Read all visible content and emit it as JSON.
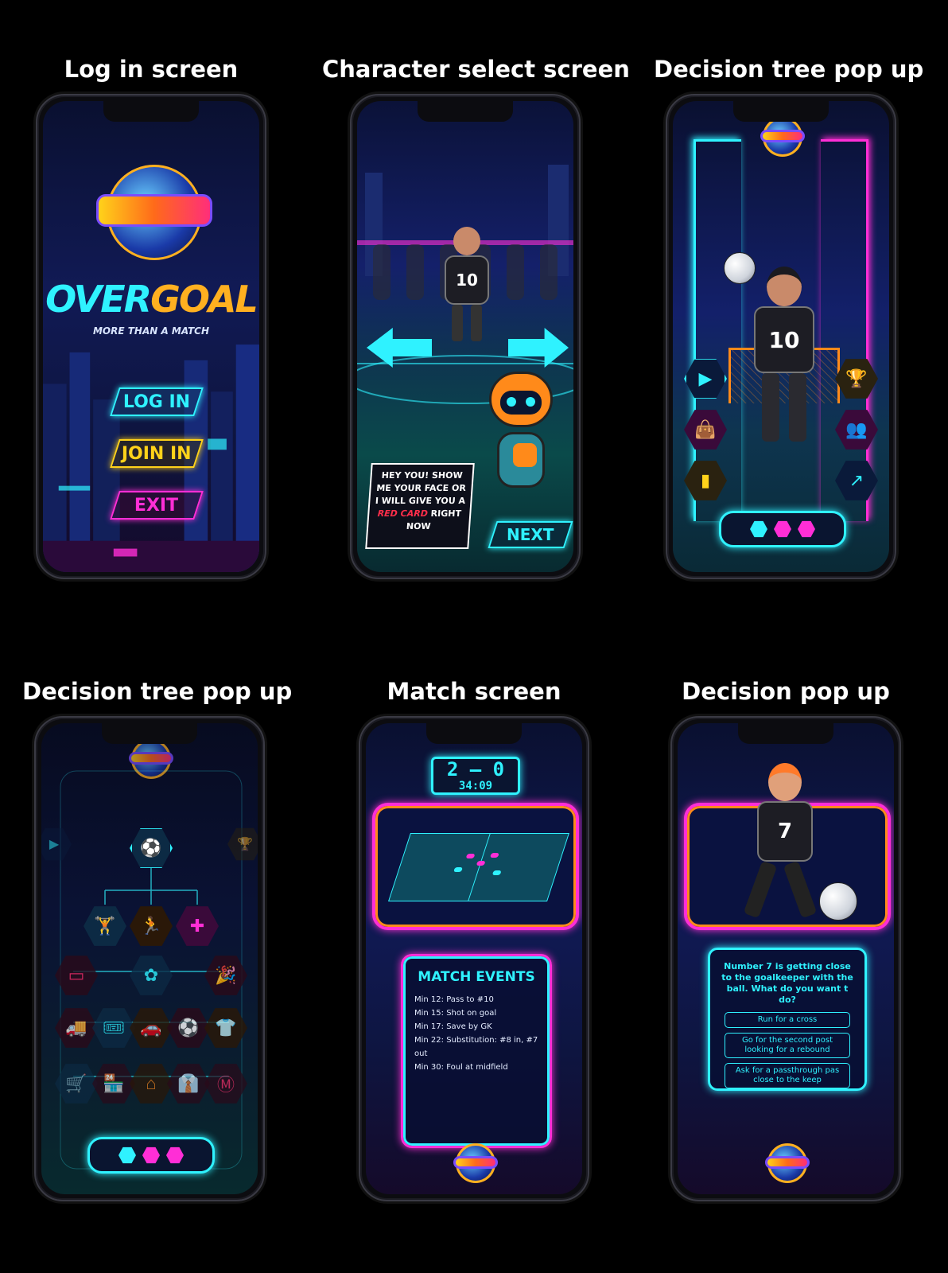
{
  "titles": {
    "login": "Log in screen",
    "character": "Character select screen",
    "tree1": "Decision tree pop up",
    "tree2": "Decision tree pop up",
    "match": "Match screen",
    "decision": "Decision pop up"
  },
  "login": {
    "logo_left": "OVER",
    "logo_right": "GOAL",
    "tagline": "MORE THAN A MATCH",
    "login_label": "LOG IN",
    "join_label": "JOIN IN",
    "exit_label": "EXIT"
  },
  "character": {
    "player_number": "10",
    "speech_line1": "HEY YOU! SHOW",
    "speech_line2": "ME YOUR FACE OR",
    "speech_line3": "I WILL GIVE YOU A",
    "speech_red": "RED CARD",
    "speech_line4_rest": " RIGHT",
    "speech_line5": "NOW",
    "next_label": "NEXT"
  },
  "tree1": {
    "player_number": "10"
  },
  "match": {
    "score": "2 – 0",
    "clock": "34:09",
    "events_title": "MATCH EVENTS",
    "events": [
      "Min 12: Pass to #10",
      "Min 15: Shot on goal",
      "Min 17: Save by GK",
      "Min 22: Substitution: #8 in, #7 out",
      "Min 30: Foul at midfield"
    ]
  },
  "decision": {
    "player_number": "7",
    "question": "Number 7 is getting close to the goalkeeper with the ball. What do you want t do?",
    "options": [
      "Run for a cross",
      "Go for the second post looking for a rebound",
      "Ask for a passthrough pas close to the keep"
    ]
  },
  "colors": {
    "cyan": "#2ff2ff",
    "magenta": "#ff2ed6",
    "orange": "#ff8a1a",
    "yellow": "#ffd21a",
    "purple": "#8a4cff"
  }
}
